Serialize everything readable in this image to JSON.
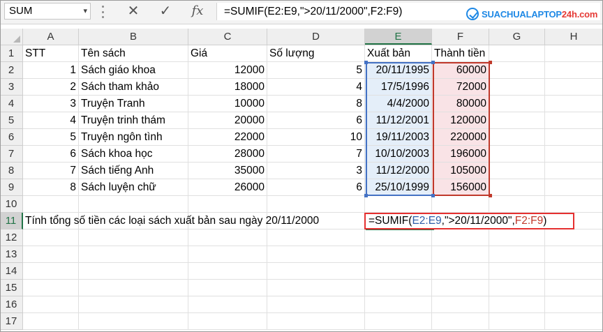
{
  "formula_bar": {
    "name_box": "SUM",
    "name_box_dropdown": "▾",
    "cancel_glyph": "✕",
    "enter_glyph": "✓",
    "fx_label": "fx",
    "formula": "=SUMIF(E2:E9,\">20/11/2000\",F2:F9)"
  },
  "logo": {
    "prefix": "SUACHUALAPTOP",
    "suffix": "24h.com"
  },
  "columns": [
    "A",
    "B",
    "C",
    "D",
    "E",
    "F",
    "G",
    "H"
  ],
  "selected_column": "E",
  "rows": [
    "1",
    "2",
    "3",
    "4",
    "5",
    "6",
    "7",
    "8",
    "9",
    "10",
    "11",
    "12",
    "13",
    "14",
    "15",
    "16",
    "17"
  ],
  "selected_row": "11",
  "headers": {
    "stt": "STT",
    "ten_sach": "Tên sách",
    "gia": "Giá",
    "so_luong": "Số lượng",
    "xuat_ban": "Xuất bản",
    "thanh_tien": "Thành tiền"
  },
  "table": [
    {
      "stt": "1",
      "ten_sach": "Sách giáo khoa",
      "gia": "12000",
      "so_luong": "5",
      "xuat_ban": "20/11/1995",
      "thanh_tien": "60000"
    },
    {
      "stt": "2",
      "ten_sach": "Sách tham khảo",
      "gia": "18000",
      "so_luong": "4",
      "xuat_ban": "17/5/1996",
      "thanh_tien": "72000"
    },
    {
      "stt": "3",
      "ten_sach": "Truyện Tranh",
      "gia": "10000",
      "so_luong": "8",
      "xuat_ban": "4/4/2000",
      "thanh_tien": "80000"
    },
    {
      "stt": "4",
      "ten_sach": "Truyện trinh thám",
      "gia": "20000",
      "so_luong": "6",
      "xuat_ban": "11/12/2001",
      "thanh_tien": "120000"
    },
    {
      "stt": "5",
      "ten_sach": "Truyện ngôn tình",
      "gia": "22000",
      "so_luong": "10",
      "xuat_ban": "19/11/2003",
      "thanh_tien": "220000"
    },
    {
      "stt": "6",
      "ten_sach": "Sách khoa học",
      "gia": "28000",
      "so_luong": "7",
      "xuat_ban": "10/10/2003",
      "thanh_tien": "196000"
    },
    {
      "stt": "7",
      "ten_sach": "Sách tiếng Anh",
      "gia": "35000",
      "so_luong": "3",
      "xuat_ban": "11/12/2000",
      "thanh_tien": "105000"
    },
    {
      "stt": "8",
      "ten_sach": "Sách luyện chữ",
      "gia": "26000",
      "so_luong": "6",
      "xuat_ban": "25/10/1999",
      "thanh_tien": "156000"
    }
  ],
  "note": "Tính tổng số tiền các loại sách xuất bản sau ngày 20/11/2000",
  "cell_formula": {
    "prefix": "=SUMIF(",
    "range1": "E2:E9",
    "criteria": ",\">20/11/2000\",",
    "range2": "F2:F9",
    "suffix": ")"
  },
  "colors": {
    "excel_green": "#217346",
    "range_blue": "#4472c4",
    "range_red": "#c0392b",
    "highlight_box": "#e53030"
  }
}
